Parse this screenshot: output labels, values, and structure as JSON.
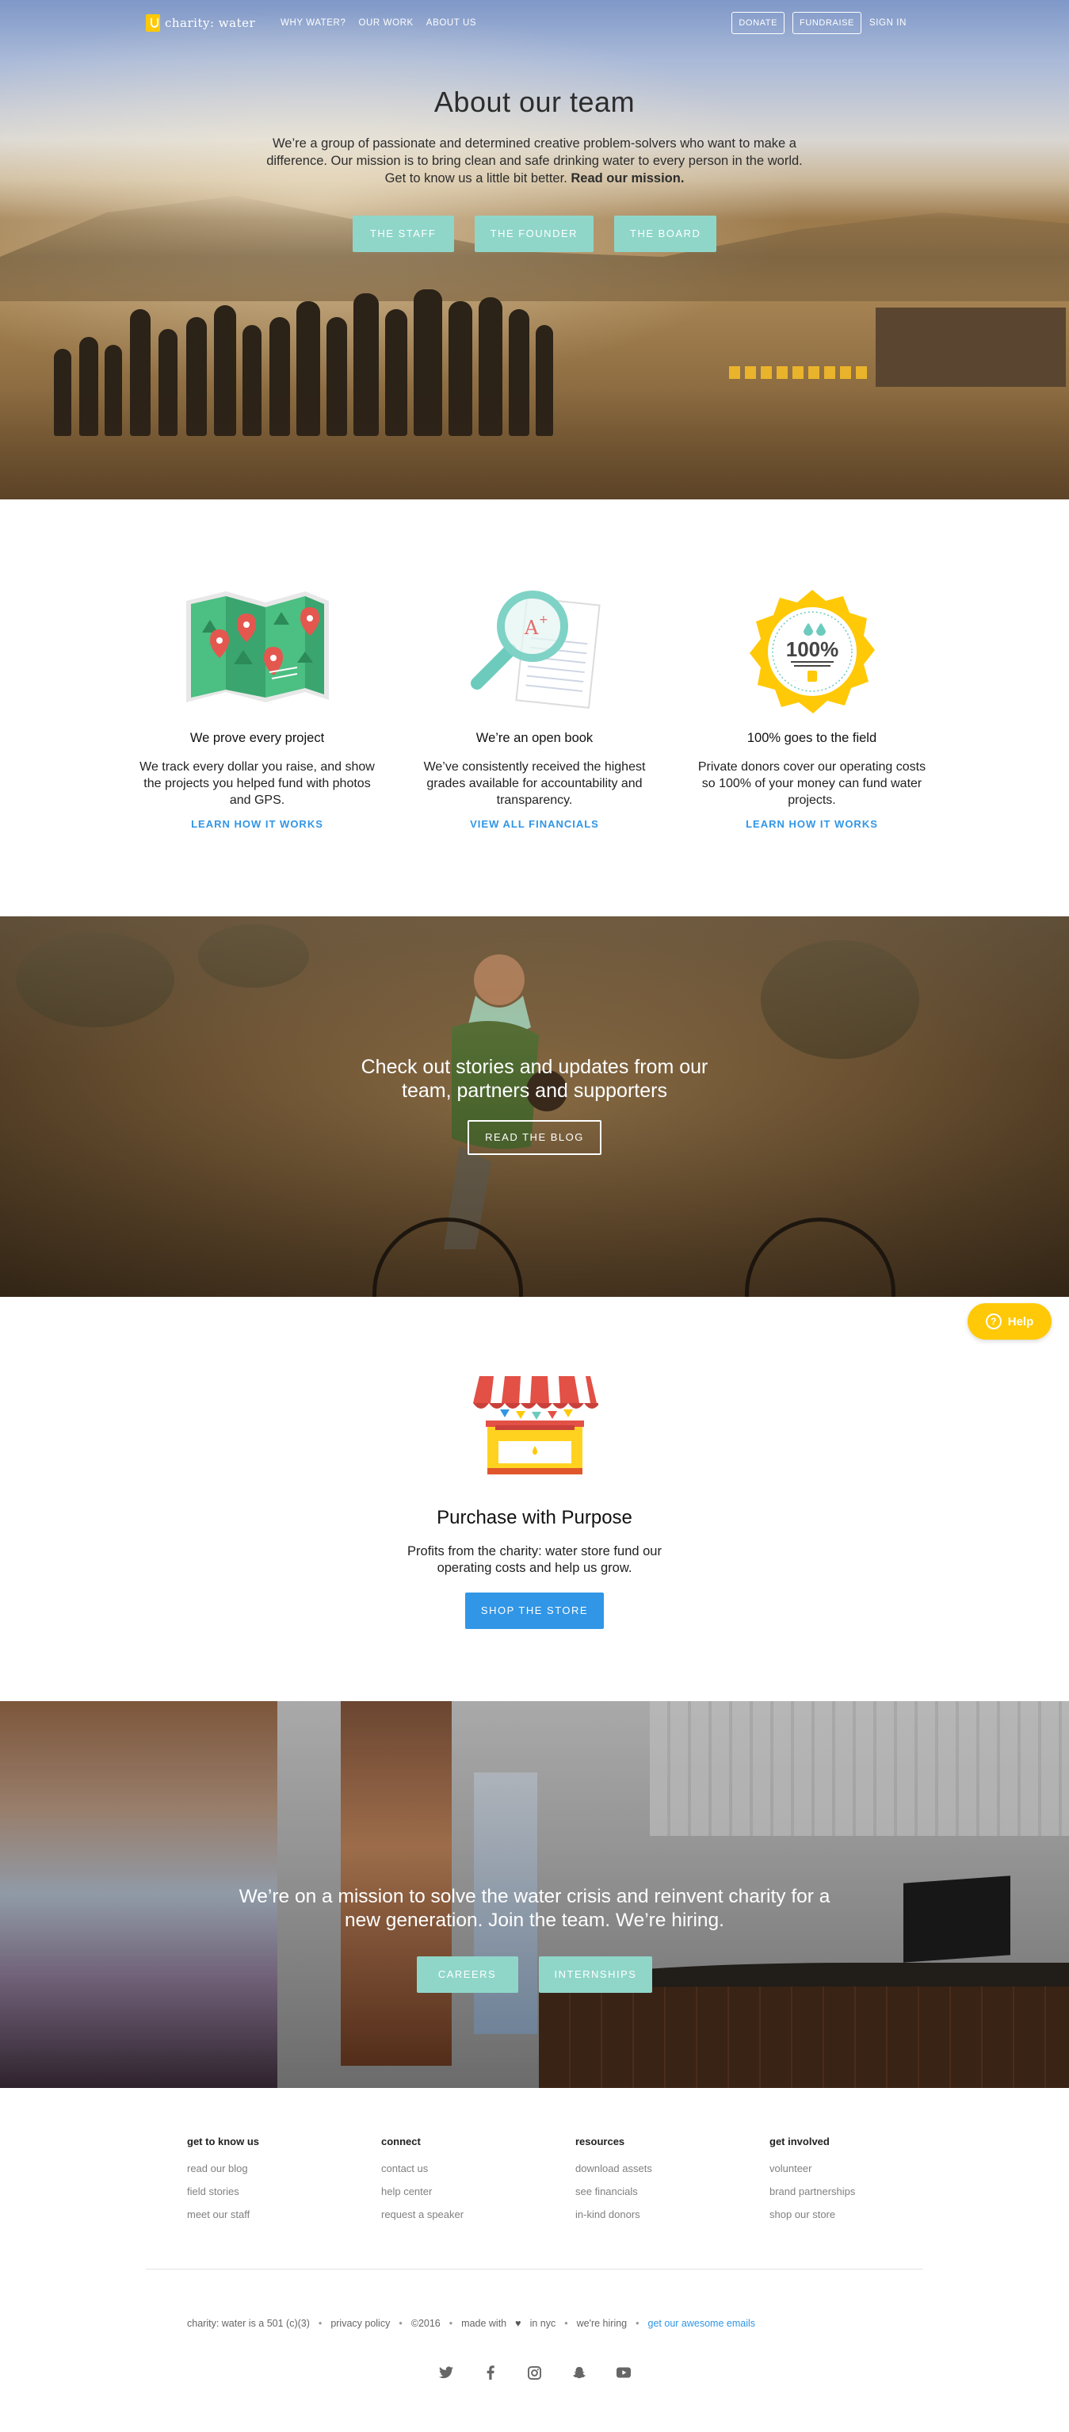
{
  "nav": {
    "logo_text": "charity: water",
    "links": [
      "WHY WATER?",
      "OUR WORK",
      "ABOUT US"
    ],
    "donate": "DONATE",
    "fundraise": "FUNDRAISE",
    "sign_in": "SIGN IN"
  },
  "hero": {
    "title": "About our team",
    "body": "We’re a group of passionate and determined creative problem-solvers who want to make a difference. Our mission is to bring clean and safe drinking water to every person in the world. Get to know us a little bit better.",
    "mission_link": "Read our mission.",
    "buttons": [
      "THE STAFF",
      "THE FOUNDER",
      "THE BOARD"
    ]
  },
  "values": [
    {
      "title": "We prove every project",
      "body": "We track every dollar you raise, and show the projects you helped fund with photos and GPS.",
      "link": "LEARN HOW IT WORKS",
      "icon": "map-icon"
    },
    {
      "title": "We’re an open book",
      "body": "We’ve consistently received the highest grades available for accountability and transparency.",
      "link": "VIEW ALL FINANCIALS",
      "icon": "magnifier-icon"
    },
    {
      "title": "100% goes to the field",
      "body": "Private donors cover our operating costs so 100% of your money can fund water projects.",
      "link": "LEARN HOW IT WORKS",
      "icon": "badge-icon",
      "badge_text": "100%"
    }
  ],
  "blog": {
    "title": "Check out stories and updates from our team, partners and supporters",
    "button": "READ THE BLOG"
  },
  "store": {
    "title": "Purchase with Purpose",
    "body": "Profits from the charity: water store fund our operating costs and help us grow.",
    "button": "SHOP THE STORE",
    "help": "Help"
  },
  "hire": {
    "title": "We’re on a mission to solve the water crisis and reinvent charity for a new generation. Join the team. We’re hiring.",
    "buttons": [
      "CAREERS",
      "INTERNSHIPS"
    ]
  },
  "footer": {
    "columns": [
      {
        "heading": "get to know us",
        "links": [
          "read our blog",
          "field stories",
          "meet our staff"
        ]
      },
      {
        "heading": "connect",
        "links": [
          "contact us",
          "help center",
          "request a speaker"
        ]
      },
      {
        "heading": "resources",
        "links": [
          "download assets",
          "see financials",
          "in-kind donors"
        ]
      },
      {
        "heading": "get involved",
        "links": [
          "volunteer",
          "brand partnerships",
          "shop our store"
        ]
      }
    ],
    "legal": "charity: water is a 501 (c)(3)",
    "privacy": "privacy policy",
    "copyright": "©2016",
    "made_with": "made with",
    "in_nyc": "in nyc",
    "hiring": "we're hiring",
    "emails": "get our awesome emails",
    "social": [
      "twitter-icon",
      "facebook-icon",
      "instagram-icon",
      "snapchat-icon",
      "youtube-icon"
    ]
  },
  "colors": {
    "teal_button": "#8fd6c9",
    "blue_accent": "#3196e6",
    "yellow_brand": "#ffc907"
  }
}
